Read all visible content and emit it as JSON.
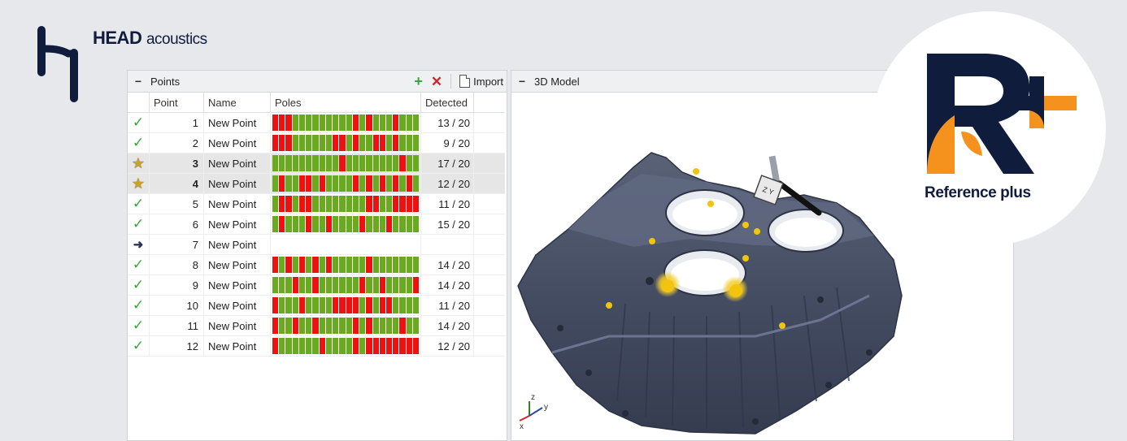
{
  "brand": {
    "name_bold": "HEAD",
    "name_rest": "acoustics",
    "product": "Reference plus"
  },
  "colors": {
    "accent_orange": "#f5921e",
    "navy": "#0f1c3c",
    "pass_green": "#6aaa1e",
    "fail_red": "#ee1111"
  },
  "points_panel": {
    "title": "Points",
    "collapse_icon": "minus-icon",
    "import_label": "Import",
    "columns": [
      "Point",
      "Name",
      "Poles",
      "Detected"
    ],
    "rows": [
      {
        "status": "check",
        "point": "1",
        "name": "New Point",
        "detected": "13 / 20",
        "poles": "RRRGGGGGGGGGRGRGGGRGGG"
      },
      {
        "status": "check",
        "point": "2",
        "name": "New Point",
        "detected": "9 / 20",
        "poles": "RRRGGGGGGRRGRGGRRGRGGG"
      },
      {
        "status": "star",
        "point": "3",
        "name": "New Point",
        "detected": "17 / 20",
        "poles": "GGGGGGGGGGRGGGGGGGGRGG"
      },
      {
        "status": "star",
        "point": "4",
        "name": "New Point",
        "detected": "12 / 20",
        "poles": "GRGGRRGRGGGGRGRGRGRGRG"
      },
      {
        "status": "check",
        "point": "5",
        "name": "New Point",
        "detected": "11 / 20",
        "poles": "GRRGRRGGGGGGGGRRGGRRRR"
      },
      {
        "status": "check",
        "point": "6",
        "name": "New Point",
        "detected": "15 / 20",
        "poles": "GRGGGRGGRGGGGRGGGRGGGG"
      },
      {
        "status": "arrow",
        "point": "7",
        "name": "New Point",
        "detected": "",
        "poles": ""
      },
      {
        "status": "check",
        "point": "8",
        "name": "New Point",
        "detected": "14 / 20",
        "poles": "RGRGRGRGRGGGGGRGGGGGGG"
      },
      {
        "status": "check",
        "point": "9",
        "name": "New Point",
        "detected": "14 / 20",
        "poles": "GGGRGGRGGGGGGRGGRGGGGR"
      },
      {
        "status": "check",
        "point": "10",
        "name": "New Point",
        "detected": "11 / 20",
        "poles": "RGGGRGGGGRRRRGRGRRGGGG"
      },
      {
        "status": "check",
        "point": "11",
        "name": "New Point",
        "detected": "14 / 20",
        "poles": "RGGRGGRGGGGGRGRGGGGRGG"
      },
      {
        "status": "check",
        "point": "12",
        "name": "New Point",
        "detected": "12 / 20",
        "poles": "RGGGGGGRGGGGRGRRRRRRRR"
      }
    ]
  },
  "model_panel": {
    "title": "3D Model",
    "axes": {
      "x": "x",
      "y": "y",
      "z": "z"
    }
  }
}
